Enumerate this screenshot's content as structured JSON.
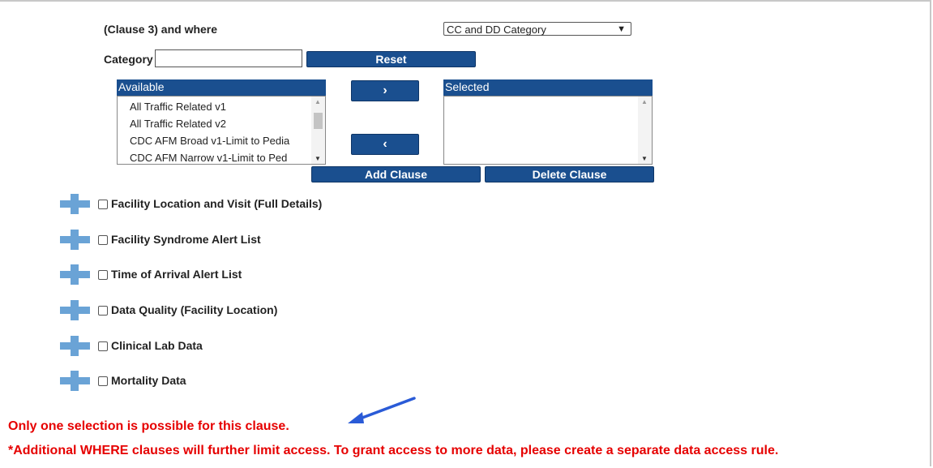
{
  "clause": {
    "label": "(Clause 3) and where",
    "select_value": "CC and DD Category"
  },
  "category": {
    "label": "Category",
    "input_value": "",
    "reset_label": "Reset"
  },
  "available": {
    "header": "Available",
    "items": [
      "All Traffic Related v1",
      "All Traffic Related v2",
      "CDC AFM Broad v1-Limit to Pedia",
      "CDC AFM Narrow v1-Limit to Ped"
    ]
  },
  "selected": {
    "header": "Selected",
    "items": []
  },
  "transfer": {
    "move_right_glyph": "›",
    "move_left_glyph": "‹"
  },
  "actions": {
    "add_clause": "Add Clause",
    "delete_clause": "Delete Clause"
  },
  "sections": [
    "Facility Location and Visit (Full Details)",
    "Facility Syndrome Alert List",
    "Time of Arrival Alert List",
    "Data Quality (Facility Location)",
    "Clinical Lab Data",
    "Mortality Data"
  ],
  "notes": {
    "single_selection": "Only one selection is possible for this clause.",
    "where_clause_warning": "*Additional WHERE clauses will further limit access. To grant access to more data, please create a separate data access rule."
  },
  "colors": {
    "button_blue": "#1a4f8f",
    "plus_icon_blue": "#6aa3d6",
    "warning_red": "#e60000",
    "annotation_arrow": "#2a5bd7"
  }
}
